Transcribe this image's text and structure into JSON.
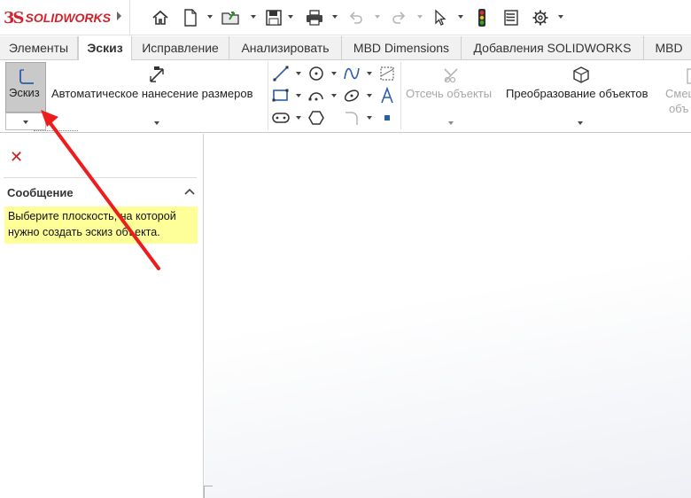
{
  "app": {
    "logo_ds": "3S",
    "logo_solid": "SOLID",
    "logo_works": "WORKS"
  },
  "tabs": [
    {
      "label": "Элементы"
    },
    {
      "label": "Эскиз",
      "active": true
    },
    {
      "label": "Исправление"
    },
    {
      "label": "Анализировать"
    },
    {
      "label": "MBD Dimensions"
    },
    {
      "label": "Добавления SOLIDWORKS"
    },
    {
      "label": "MBD"
    }
  ],
  "ribbon": {
    "sketch_label": "Эскиз",
    "smart_dim_label": "Автоматическое нанесение размеров",
    "trim_label": "Отсечь объекты",
    "convert_label": "Преобразование объектов",
    "offset_label_1": "Смещ",
    "offset_label_2": "объ"
  },
  "panel": {
    "message_title": "Сообщение",
    "message_text": "Выберите плоскость, на которой нужно создать эскиз объекта."
  },
  "colors": {
    "brand": "#d2232a",
    "annotation_arrow": "#ee1c1c",
    "message_bg": "#ffff99",
    "active_button": "#c9c9c9"
  }
}
